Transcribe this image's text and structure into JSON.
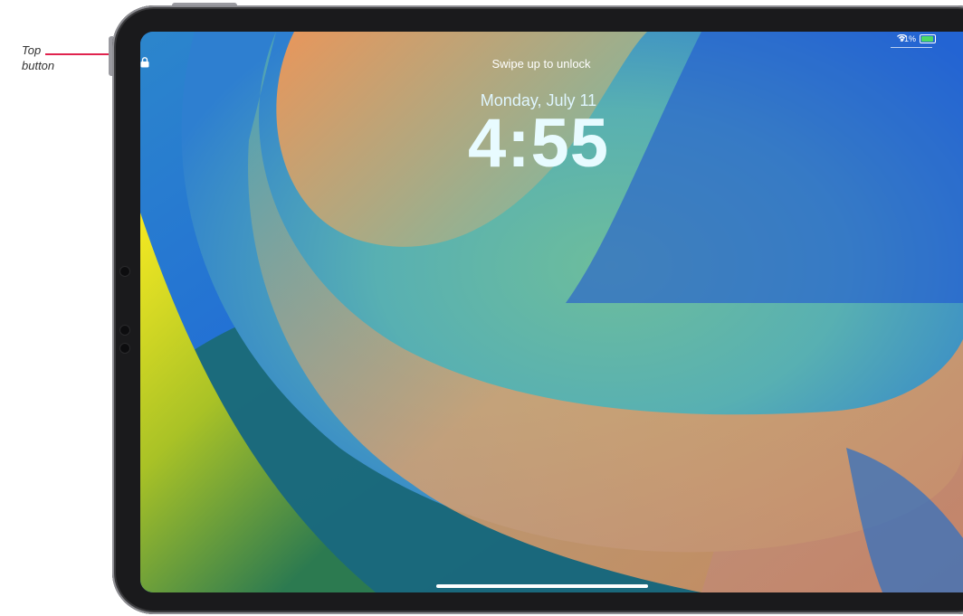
{
  "callout": {
    "label": "Top button"
  },
  "status": {
    "battery_text": "91%"
  },
  "lock_screen": {
    "unlock_hint": "Swipe up to unlock",
    "date": "Monday, July 11",
    "time": "4:55"
  },
  "colors": {
    "callout_line": "#e0234e",
    "wallpaper_blue": "#1f5fd0",
    "wallpaper_teal": "#5bbaa4",
    "wallpaper_orange": "#e79c5b",
    "wallpaper_yellow": "#f3e021",
    "battery_green": "#4cd964"
  }
}
